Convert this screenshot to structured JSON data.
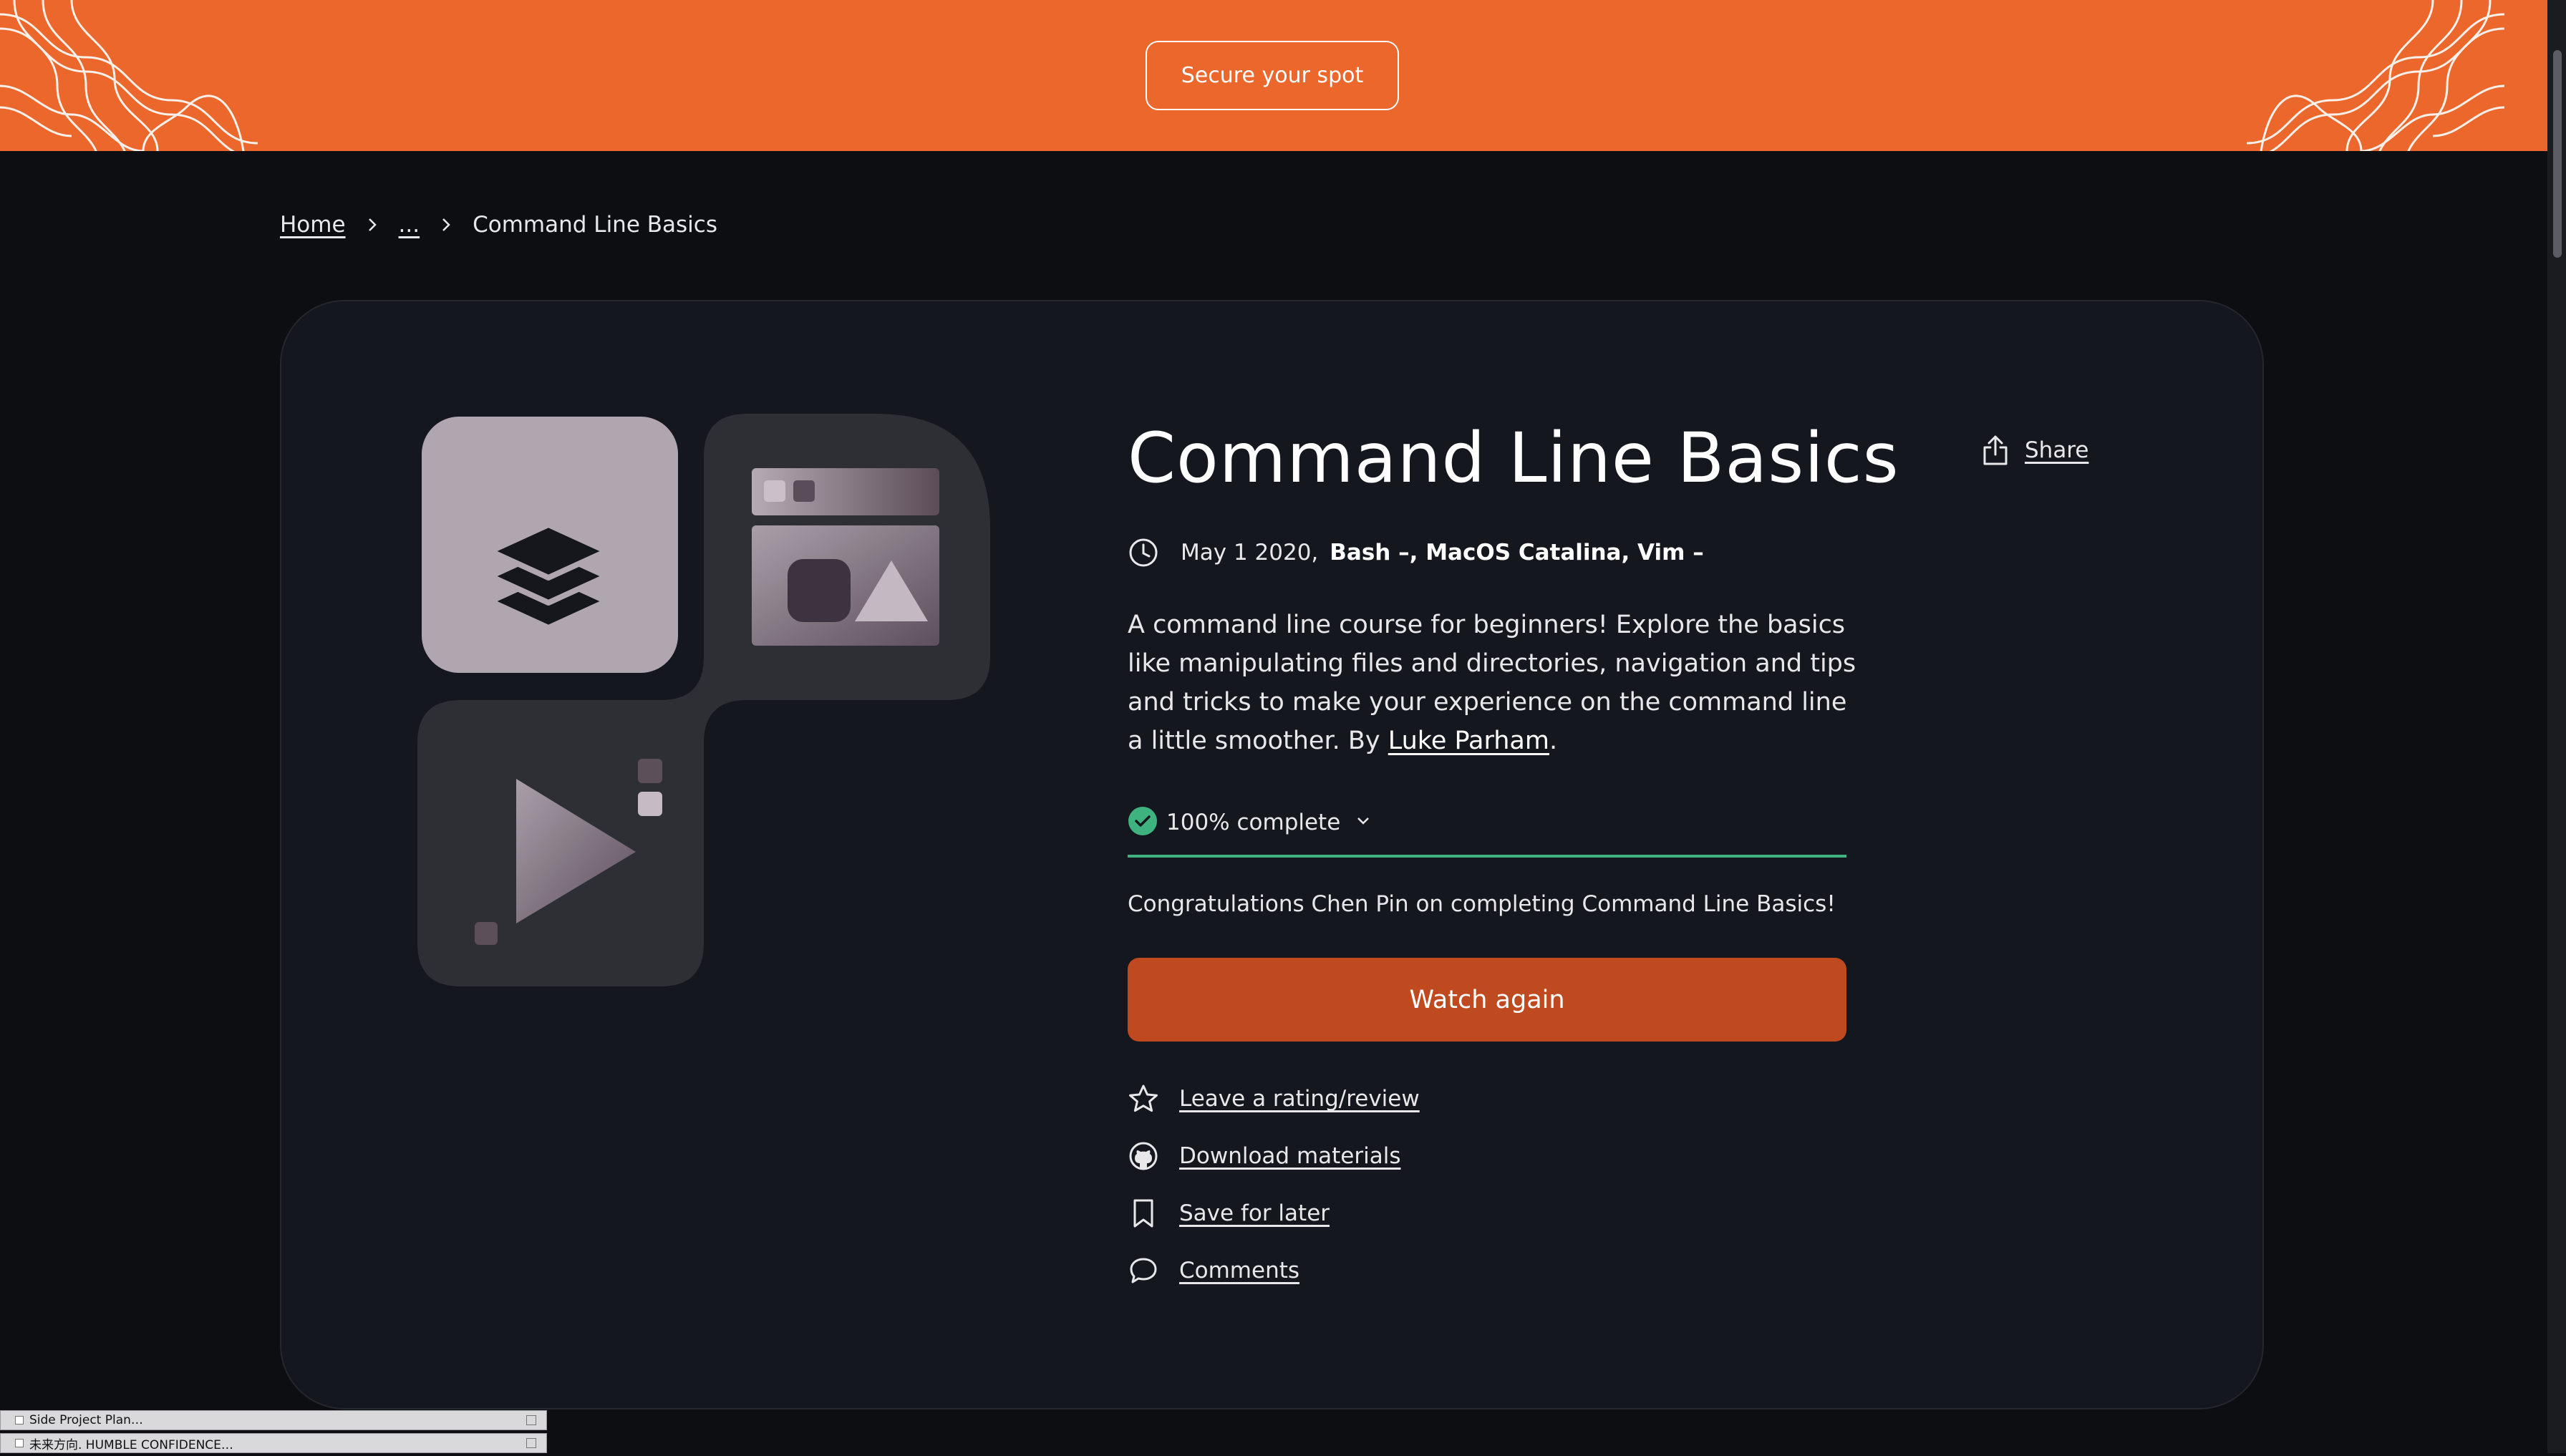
{
  "banner": {
    "cta_label": "Secure your spot",
    "color": "#ec672c"
  },
  "breadcrumb": {
    "home": "Home",
    "ellipsis": "...",
    "current": "Command Line Basics"
  },
  "course": {
    "title": "Command Line Basics",
    "share_label": "Share",
    "date": "May 1 2020,",
    "tags": "Bash –, MacOS Catalina, Vim –",
    "description_prefix": "A command line course for beginners! Explore the basics like manipulating files and directories, navigation and tips and tricks to make your experience on the command line a little smoother. By ",
    "author": "Luke Parham",
    "description_suffix": ".",
    "progress_percent": 100,
    "progress_label": "100% complete",
    "congrats": "Congratulations Chen Pin on completing Command Line Basics!",
    "watch_label": "Watch again",
    "accent_color": "#bf4a20",
    "progress_color": "#3fb37f"
  },
  "actions": [
    {
      "icon": "star-icon",
      "label": "Leave a rating/review"
    },
    {
      "icon": "github-icon",
      "label": "Download materials"
    },
    {
      "icon": "bookmark-icon",
      "label": "Save for later"
    },
    {
      "icon": "comment-icon",
      "label": "Comments"
    }
  ],
  "taskbar": {
    "items": [
      "Side Project Plan…",
      "未来方向. HUMBLE CONFIDENCE…"
    ]
  }
}
